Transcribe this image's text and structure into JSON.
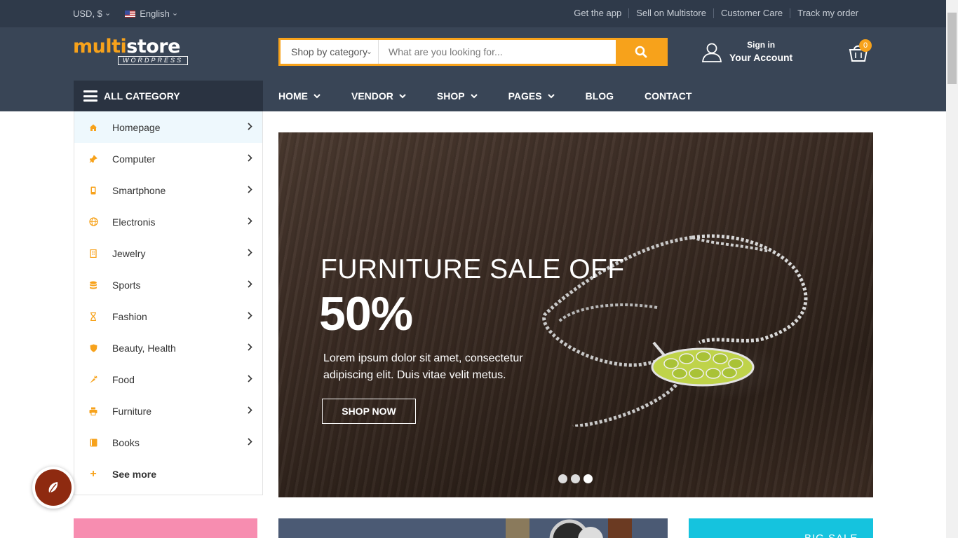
{
  "topbar": {
    "currency": "USD, $",
    "language": "English",
    "links": [
      "Get the app",
      "Sell on Multistore",
      "Customer Care",
      "Track my order"
    ]
  },
  "header": {
    "logo_main_a": "multi",
    "logo_main_b": "store",
    "logo_sub": "WORDPRESS",
    "search_category": "Shop by category",
    "search_placeholder": "What are you looking for...",
    "account_line1": "Sign in",
    "account_line2": "Your Account",
    "cart_count": "0"
  },
  "nav": {
    "all_category": "ALL CATEGORY",
    "items": [
      {
        "label": "HOME",
        "has_dropdown": true
      },
      {
        "label": "VENDOR",
        "has_dropdown": true
      },
      {
        "label": "SHOP",
        "has_dropdown": true
      },
      {
        "label": "PAGES",
        "has_dropdown": true
      },
      {
        "label": "BLOG",
        "has_dropdown": false
      },
      {
        "label": "CONTACT",
        "has_dropdown": false
      }
    ]
  },
  "sidebar": {
    "items": [
      {
        "label": "Homepage",
        "icon": "home-icon"
      },
      {
        "label": "Computer",
        "icon": "pin-icon"
      },
      {
        "label": "Smartphone",
        "icon": "smartphone-icon"
      },
      {
        "label": "Electronis",
        "icon": "globe-icon"
      },
      {
        "label": "Jewelry",
        "icon": "building-icon"
      },
      {
        "label": "Sports",
        "icon": "database-icon"
      },
      {
        "label": "Fashion",
        "icon": "hourglass-icon"
      },
      {
        "label": "Beauty, Health",
        "icon": "shield-icon"
      },
      {
        "label": "Food",
        "icon": "carrot-icon"
      },
      {
        "label": "Furniture",
        "icon": "printer-icon"
      },
      {
        "label": "Books",
        "icon": "book-icon"
      }
    ],
    "see_more": "See more"
  },
  "hero": {
    "headline": "FURNITURE SALE OFF",
    "discount": "50%",
    "description": "Lorem ipsum dolor sit amet, consectetur adipiscing elit. Duis vitae velit metus.",
    "button": "SHOP NOW",
    "slides": 3,
    "active_slide": 3
  },
  "banners": {
    "right_partial": "BIG SALE"
  },
  "colors": {
    "accent": "#f7a21b",
    "topbar": "#2f3a4a",
    "header": "#394556",
    "allcat": "#2a3341"
  }
}
